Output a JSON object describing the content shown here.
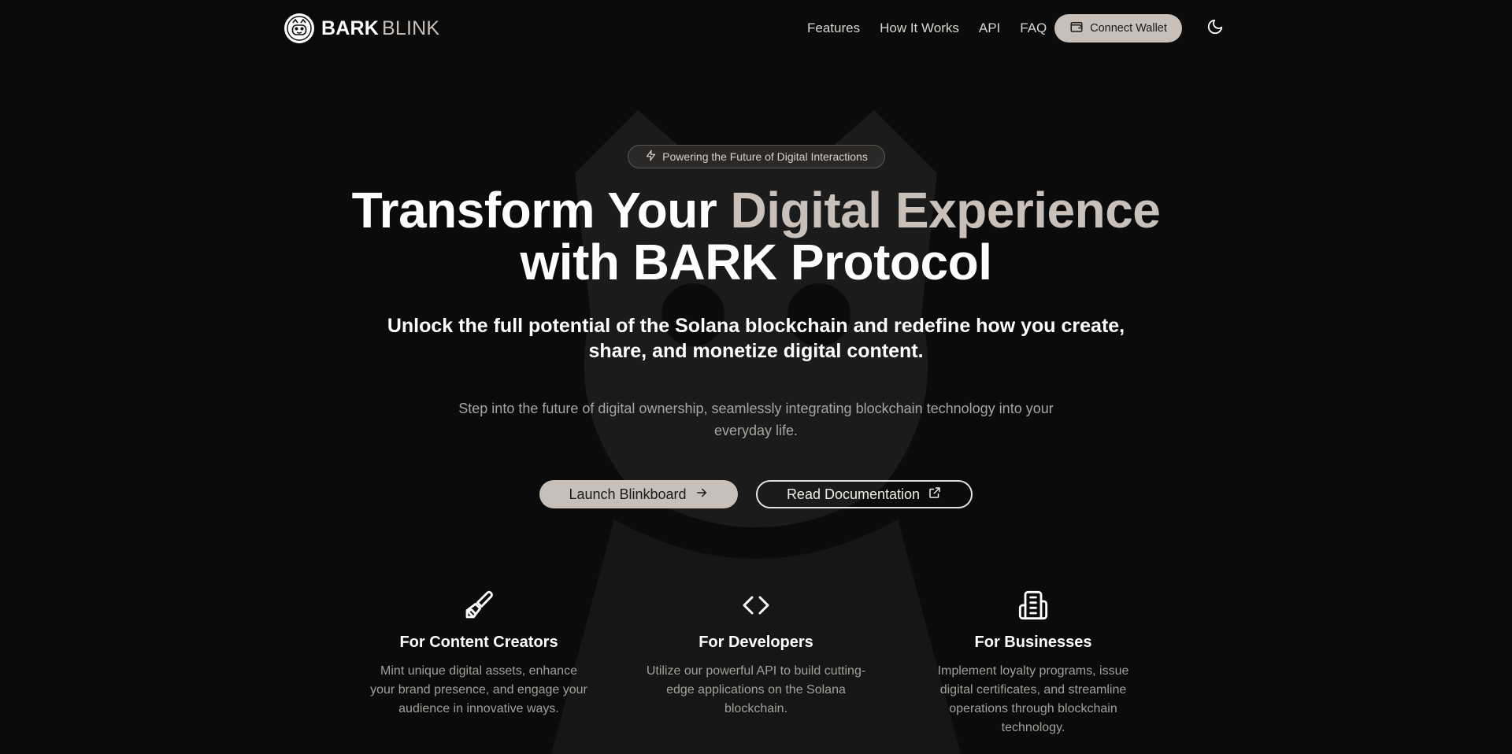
{
  "brand": {
    "name_strong": "BARK",
    "name_light": "BLINK",
    "logo_icon": "bark-mascot-logo"
  },
  "nav": {
    "links": [
      "Features",
      "How It Works",
      "API",
      "FAQ"
    ],
    "connect_wallet": "Connect Wallet",
    "wallet_icon": "wallet-icon",
    "theme_icon": "moon-icon"
  },
  "hero": {
    "badge": "Powering the Future of Digital Interactions",
    "badge_icon": "lightning-icon",
    "title_part1": "Transform Your ",
    "title_accent": "Digital Experience",
    "title_part2": "with BARK Protocol",
    "subtitle": "Unlock the full potential of the Solana blockchain and redefine how you create, share, and monetize digital content.",
    "lead": "Step into the future of digital ownership, seamlessly integrating blockchain technology into your everyday life.",
    "cta_primary": "Launch Blinkboard",
    "cta_primary_icon": "arrow-right-icon",
    "cta_secondary": "Read Documentation",
    "cta_secondary_icon": "external-link-icon"
  },
  "features": [
    {
      "icon": "paintbrush-icon",
      "title": "For Content Creators",
      "text": "Mint unique digital assets, enhance your brand presence, and engage your audience in innovative ways."
    },
    {
      "icon": "code-icon",
      "title": "For Developers",
      "text": "Utilize our powerful API to build cutting-edge applications on the Solana blockchain."
    },
    {
      "icon": "building-icon",
      "title": "For Businesses",
      "text": "Implement loyalty programs, issue digital certificates, and streamline operations through blockchain technology."
    }
  ],
  "colors": {
    "background": "#0b0b0c",
    "accent": "#c7bfb8",
    "muted_text": "#a3a09b"
  }
}
